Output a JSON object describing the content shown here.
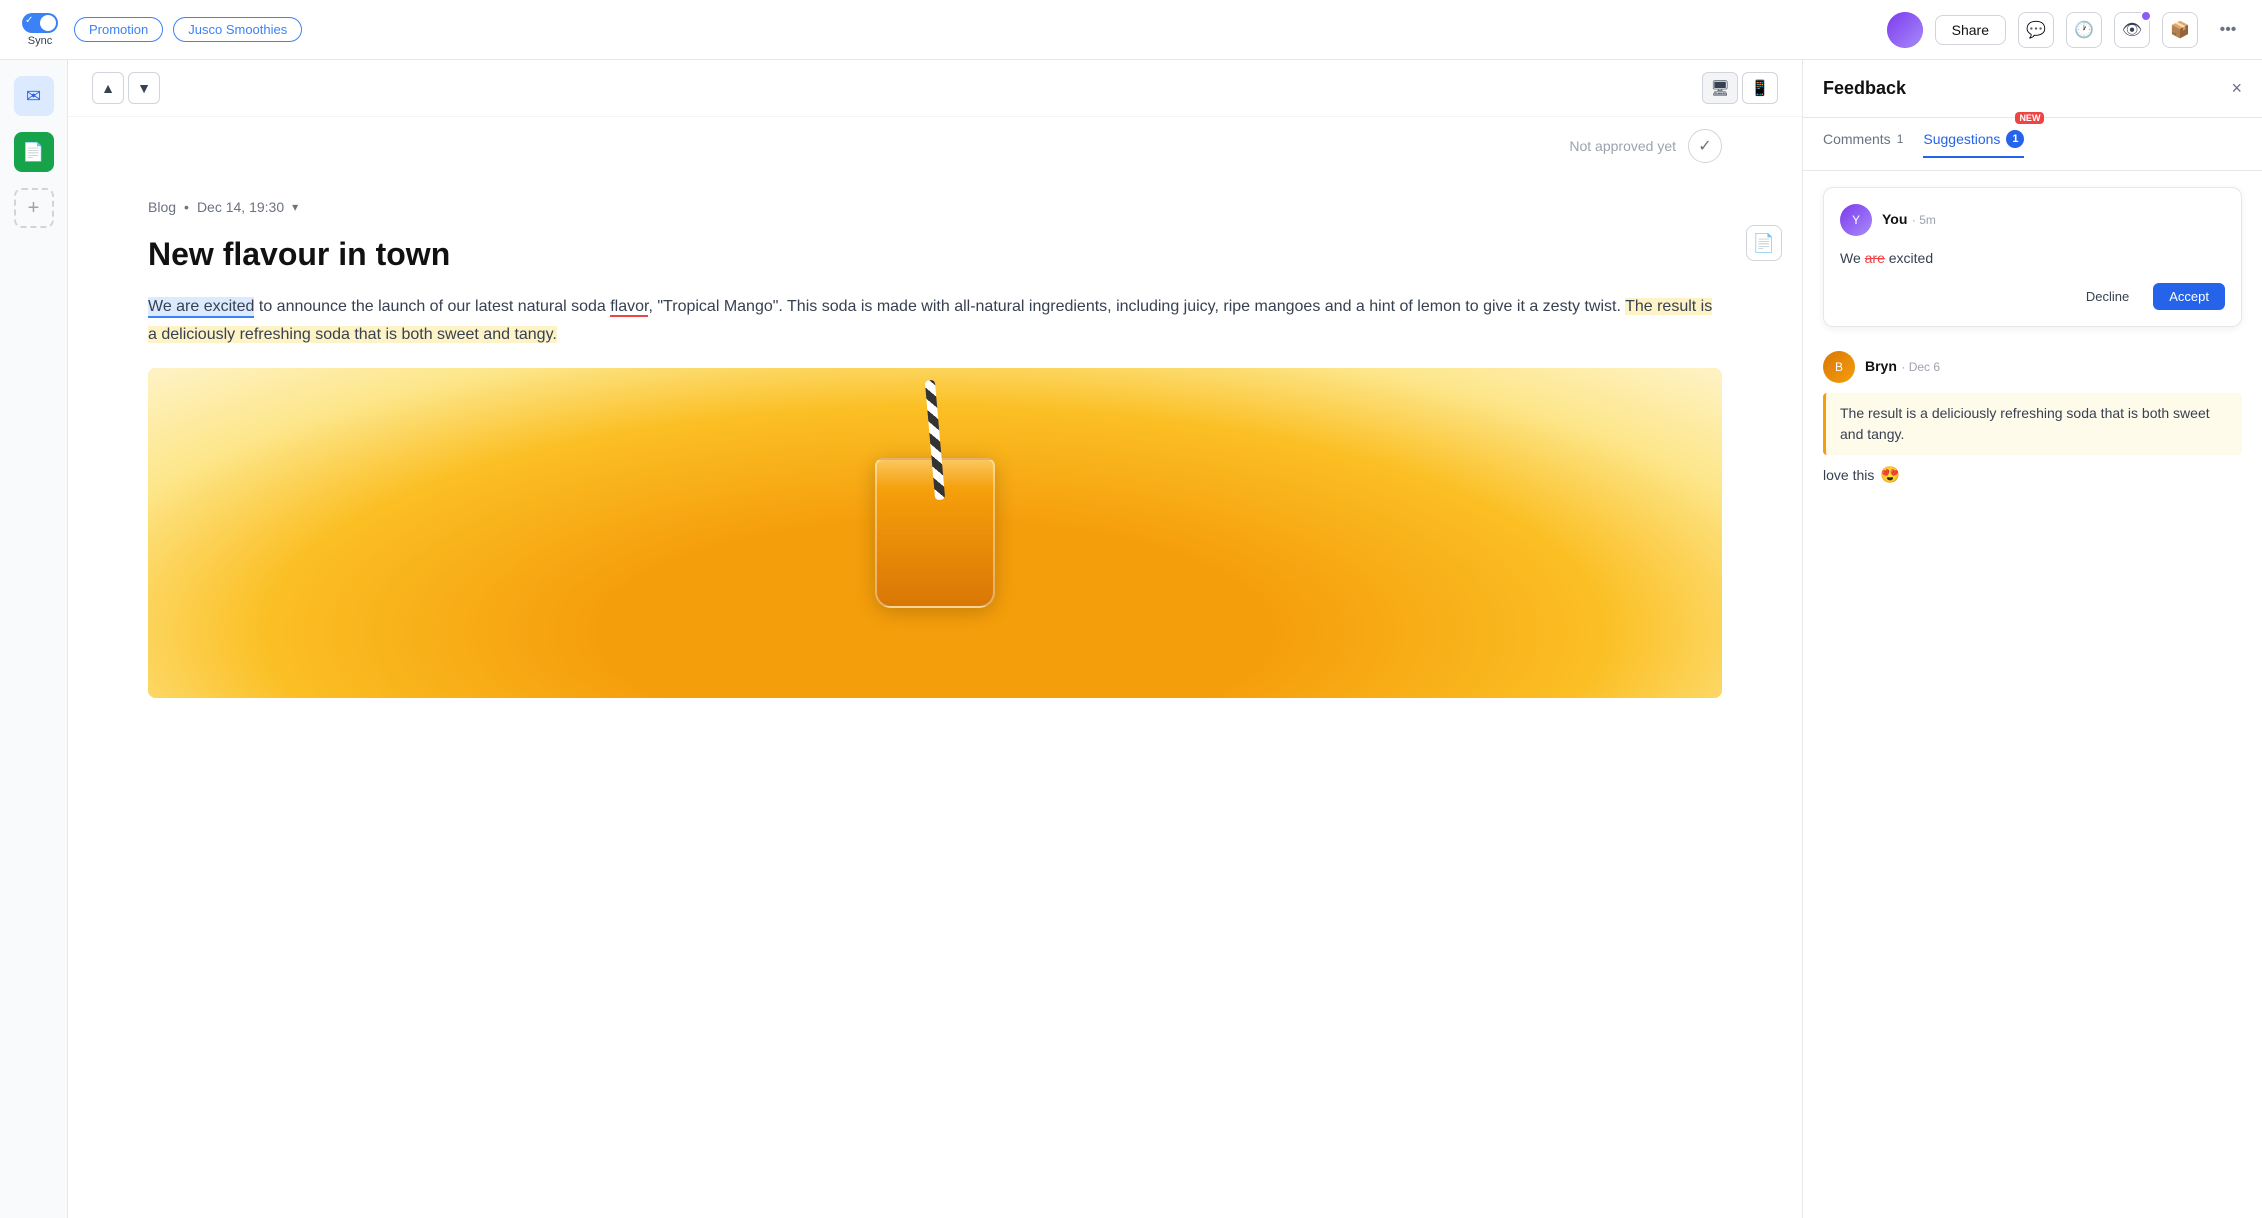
{
  "topbar": {
    "sync_label": "Sync",
    "tag1": "Promotion",
    "tag2": "Jusco Smoothies",
    "share_label": "Share"
  },
  "content": {
    "blog_source": "Blog",
    "blog_date": "Dec 14, 19:30",
    "title": "New flavour in town",
    "paragraph": "to announce the launch of our latest natural soda flavor, \"Tropical Mango\". This soda is made with all-natural ingredients, including juicy, ripe mangoes and a hint of lemon to give it a zesty twist.",
    "highlighted_start": "We are excited",
    "highlighted_end": "The result is a deliciously refreshing soda that is both sweet and tangy.",
    "approval_text": "Not approved yet"
  },
  "panel": {
    "title": "Feedback",
    "close_label": "×",
    "tabs": [
      {
        "label": "Comments",
        "count": "1",
        "active": false
      },
      {
        "label": "Suggestions",
        "count": "1",
        "active": true,
        "new_badge": "NEW"
      }
    ]
  },
  "suggestions": [
    {
      "user": "You",
      "time": "5m",
      "original": "are",
      "replacement": "",
      "text_before": "We ",
      "text_after": " excited",
      "decline_label": "Decline",
      "accept_label": "Accept"
    }
  ],
  "comments": [
    {
      "user": "Bryn",
      "date": "Dec 6",
      "quoted": "The result is a deliciously refreshing soda that is both sweet and tangy.",
      "body": "love this",
      "emoji": "😍"
    }
  ]
}
